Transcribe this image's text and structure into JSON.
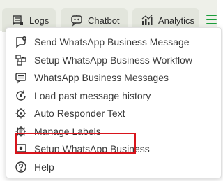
{
  "tabs": {
    "logs": {
      "label": "Logs",
      "icon": "logs-icon"
    },
    "chatbot": {
      "label": "Chatbot",
      "icon": "chatbot-icon"
    },
    "analytics": {
      "label": "Analytics",
      "icon": "analytics-icon"
    }
  },
  "menu": {
    "items": [
      {
        "label": "Send WhatsApp Business Message",
        "icon": "send-message-icon"
      },
      {
        "label": "Setup WhatsApp Business Workflow",
        "icon": "workflow-icon"
      },
      {
        "label": "WhatsApp Business Messages",
        "icon": "messages-icon"
      },
      {
        "label": "Load past message history",
        "icon": "history-icon"
      },
      {
        "label": "Auto Responder Text",
        "icon": "auto-responder-icon"
      },
      {
        "label": "Manage Labels",
        "icon": "labels-icon"
      },
      {
        "label": "Setup WhatsApp Business",
        "icon": "setup-icon"
      },
      {
        "label": "Help",
        "icon": "help-icon"
      }
    ]
  },
  "colors": {
    "accent": "#1a9e3a",
    "highlight_border": "#d8141c",
    "tab_background": "#e2e5dc",
    "topbar_background": "#eef0e9"
  }
}
